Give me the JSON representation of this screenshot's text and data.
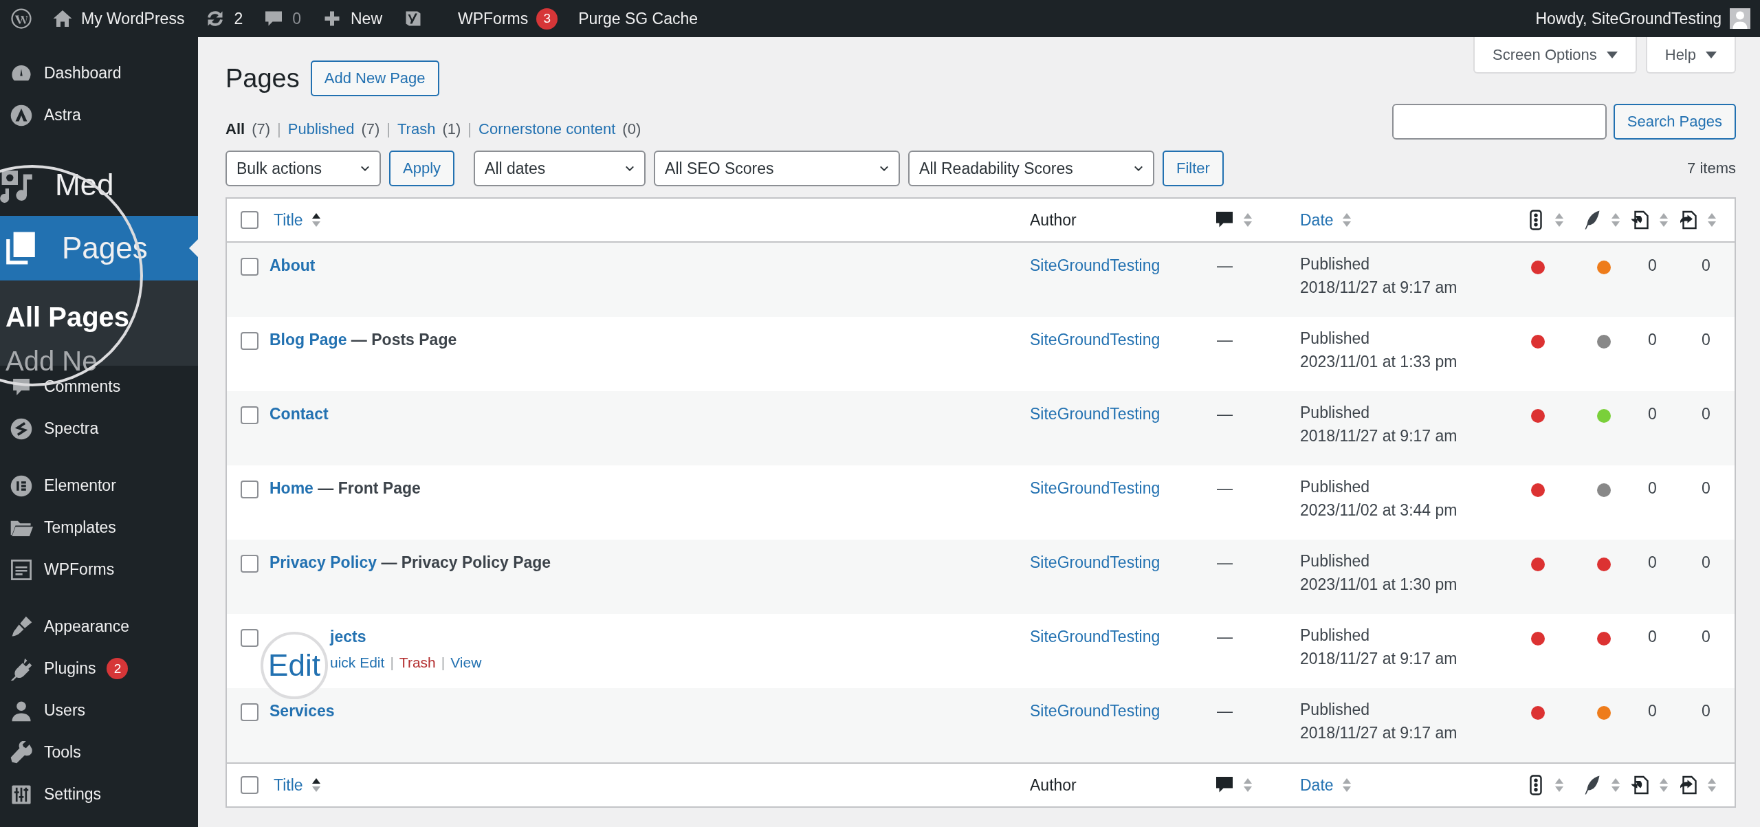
{
  "admin_bar": {
    "items": [
      {
        "kind": "wp-logo"
      },
      {
        "kind": "site",
        "label": "My WordPress"
      },
      {
        "kind": "updates",
        "label": "2"
      },
      {
        "kind": "comments",
        "label": "0"
      },
      {
        "kind": "new",
        "label": "New"
      },
      {
        "kind": "yoast"
      },
      {
        "kind": "wpforms",
        "label": "WPForms",
        "badge": "3"
      },
      {
        "kind": "text",
        "label": "Purge SG Cache"
      }
    ],
    "account": "Howdy, SiteGroundTesting"
  },
  "sidebar": {
    "top": [
      {
        "kind": "dashboard",
        "label": "Dashboard"
      },
      {
        "kind": "astra",
        "label": "Astra"
      }
    ],
    "magnifier": {
      "media_label": "Med",
      "current": {
        "label": "Pages",
        "selected": true
      },
      "submenu": [
        {
          "label": "All Pages",
          "selected": true
        },
        {
          "label": "Add Ne",
          "selected": false
        }
      ]
    },
    "groups": [
      [
        {
          "kind": "comments",
          "label": "Comments"
        },
        {
          "kind": "spectra",
          "label": "Spectra"
        }
      ],
      [
        {
          "kind": "elementor",
          "label": "Elementor"
        },
        {
          "kind": "templates",
          "label": "Templates"
        },
        {
          "kind": "wpforms",
          "label": "WPForms"
        }
      ],
      [
        {
          "kind": "appearance",
          "label": "Appearance"
        },
        {
          "kind": "plugins",
          "label": "Plugins",
          "badge": "2"
        },
        {
          "kind": "users",
          "label": "Users"
        },
        {
          "kind": "tools",
          "label": "Tools"
        },
        {
          "kind": "settings",
          "label": "Settings"
        }
      ]
    ]
  },
  "screen_tabs": [
    "Screen Options",
    "Help"
  ],
  "heading": "Pages",
  "add_new": "Add New Page",
  "views": [
    {
      "label": "All",
      "count": "(7)",
      "selected": true
    },
    {
      "separator": "|",
      "label": "Published",
      "count": "(7)",
      "selected": false
    },
    {
      "separator": "|",
      "label": "Trash",
      "count": "(1)",
      "selected": false
    },
    {
      "separator": "|",
      "label": "Cornerstone content",
      "count": "(0)",
      "selected": false
    }
  ],
  "search": {
    "button": "Search Pages"
  },
  "filters": {
    "bulk": "Bulk actions",
    "apply": "Apply",
    "selects": [
      "All dates",
      "All SEO Scores",
      "All Readability Scores"
    ],
    "filter": "Filter",
    "count": "7 items"
  },
  "table": {
    "select_all": {
      "checked": false
    },
    "columns": [
      {
        "kind": "title",
        "label": "Title",
        "sorted": true
      },
      {
        "kind": "author",
        "label": "Author"
      },
      {
        "kind": "comments",
        "sorted": false
      },
      {
        "kind": "date",
        "label": "Date",
        "sorted": false
      },
      {
        "kind": "seo",
        "sorted": false
      },
      {
        "kind": "readability",
        "sorted": false
      },
      {
        "kind": "links-in",
        "sorted": false
      },
      {
        "kind": "links-out",
        "sorted": false
      }
    ],
    "rows": [
      {
        "checked": false,
        "title": "About",
        "author": "SiteGroundTesting",
        "comments": "—",
        "status": "Published",
        "date": "2018/11/27 at 9:17 am",
        "seo_score": {
          "color": "#dc3232"
        },
        "readability_score": {
          "color": "#ee7c1b"
        },
        "links_in": "0",
        "links_out": "0"
      },
      {
        "checked": false,
        "title": "Blog Page",
        "state": "— Posts Page",
        "author": "SiteGroundTesting",
        "comments": "—",
        "status": "Published",
        "date": "2023/11/01 at 1:33 pm",
        "seo_score": {
          "color": "#dc3232"
        },
        "readability_score": {
          "color": "#888888"
        },
        "links_in": "0",
        "links_out": "0"
      },
      {
        "checked": false,
        "title": "Contact",
        "author": "SiteGroundTesting",
        "comments": "—",
        "status": "Published",
        "date": "2018/11/27 at 9:17 am",
        "seo_score": {
          "color": "#dc3232"
        },
        "readability_score": {
          "color": "#7ad03a"
        },
        "links_in": "0",
        "links_out": "0"
      },
      {
        "checked": false,
        "title": "Home",
        "state": "— Front Page",
        "author": "SiteGroundTesting",
        "comments": "—",
        "status": "Published",
        "date": "2023/11/02 at 3:44 pm",
        "seo_score": {
          "color": "#dc3232"
        },
        "readability_score": {
          "color": "#888888"
        },
        "links_in": "0",
        "links_out": "0"
      },
      {
        "checked": false,
        "title": "Privacy Policy",
        "state": "— Privacy Policy Page",
        "author": "SiteGroundTesting",
        "comments": "—",
        "status": "Published",
        "date": "2023/11/01 at 1:30 pm",
        "seo_score": {
          "color": "#dc3232"
        },
        "readability_score": {
          "color": "#dc3232"
        },
        "links_in": "0",
        "links_out": "0"
      },
      {
        "checked": false,
        "title": "jects",
        "magnified_action": "Edit",
        "actions": [
          {
            "kind": "link",
            "label": "uick Edit"
          },
          {
            "kind": "danger",
            "separator": "|",
            "label": "Trash"
          },
          {
            "kind": "link",
            "separator": "|",
            "label": "View"
          }
        ],
        "author": "SiteGroundTesting",
        "comments": "—",
        "status": "Published",
        "date": "2018/11/27 at 9:17 am",
        "seo_score": {
          "color": "#dc3232"
        },
        "readability_score": {
          "color": "#dc3232"
        },
        "links_in": "0",
        "links_out": "0"
      },
      {
        "checked": false,
        "title": "Services",
        "author": "SiteGroundTesting",
        "comments": "—",
        "status": "Published",
        "date": "2018/11/27 at 9:17 am",
        "seo_score": {
          "color": "#dc3232"
        },
        "readability_score": {
          "color": "#ee7c1b"
        },
        "links_in": "0",
        "links_out": "0"
      }
    ],
    "footer_select_all": {
      "checked": false
    },
    "footer_columns": [
      {
        "kind": "title",
        "label": "Title",
        "sorted": true
      },
      {
        "kind": "author",
        "label": "Author"
      },
      {
        "kind": "comments",
        "sorted": false
      },
      {
        "kind": "date",
        "label": "Date",
        "sorted": false
      },
      {
        "kind": "seo",
        "sorted": false
      },
      {
        "kind": "readability",
        "sorted": false
      },
      {
        "kind": "links-in",
        "sorted": false
      },
      {
        "kind": "links-out",
        "sorted": false
      }
    ]
  }
}
